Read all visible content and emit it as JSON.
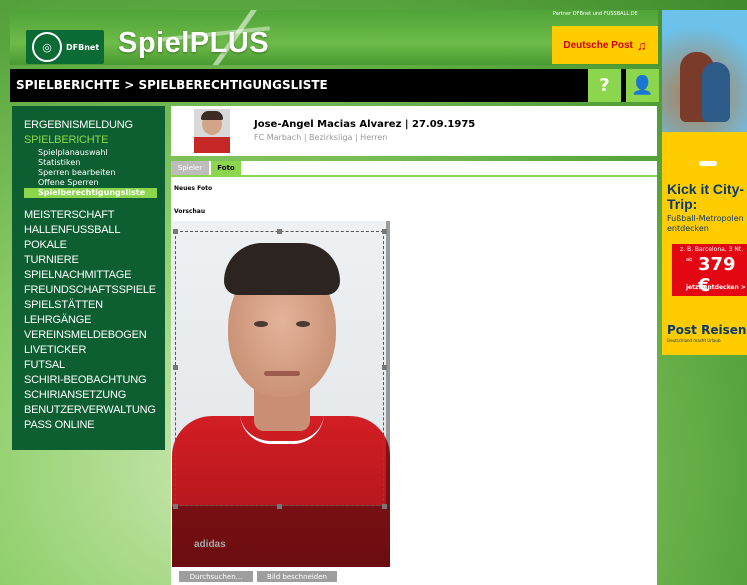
{
  "header": {
    "logo_text": "DFBnet",
    "brand": "SpielPLUS",
    "partner_note": "Partner DFBnet und FUSSBALL.DE",
    "sponsor": "Deutsche Post"
  },
  "titlebar": {
    "breadcrumb": "SPIELBERICHTE > SPIELBERECHTIGUNGSLISTE",
    "help_label": "?"
  },
  "sidebar": {
    "ergebnismeldung": "ERGEBNISMELDUNG",
    "spielberichte": "SPIELBERICHTE",
    "sub": [
      "Spielplanauswahl",
      "Statistiken",
      "Sperren bearbeiten",
      "Offene Sperren",
      "Spielberechtigungsliste"
    ],
    "items": [
      "MEISTERSCHAFT",
      "HALLENFUSSBALL",
      "POKALE",
      "TURNIERE",
      "SPIELNACHMITTAGE",
      "FREUNDSCHAFTSSPIELE",
      "SPIELSTÄTTEN",
      "LEHRGÄNGE",
      "VEREINSMELDEBOGEN",
      "LIVETICKER",
      "FUTSAL",
      "SCHIRI-BEOBACHTUNG",
      "SCHIRIANSETZUNG",
      "BENUTZERVERWALTUNG",
      "PASS ONLINE"
    ]
  },
  "profile": {
    "name": "Jose-Angel Macias Alvarez | 27.09.1975",
    "club": "FC Marbach | Bezirksliga | Herren"
  },
  "tabs": {
    "spieler": "Spieler",
    "foto": "Foto"
  },
  "photo": {
    "new_label": "Neues Foto",
    "preview_label": "Vorschau",
    "shirt_brand": "adidas",
    "browse_button": "Durchsuchen...",
    "crop_button": "Bild beschneiden"
  },
  "ad": {
    "headline": "Kick it City-Trip:",
    "subline": "Fußball-Metropolen entdecken",
    "offer_text": "z. B. Barcelona, 3 Nt.",
    "price_prefix": "ab",
    "price": "379 €",
    "cta": "jetzt entdecken >",
    "brand": "Post Reisen",
    "tagline": "Deutschland macht Urlaub"
  },
  "colors": {
    "accent": "#8cd64e",
    "sidebar_bg": "#0d5f31",
    "sponsor_bg": "#ffcc00"
  }
}
